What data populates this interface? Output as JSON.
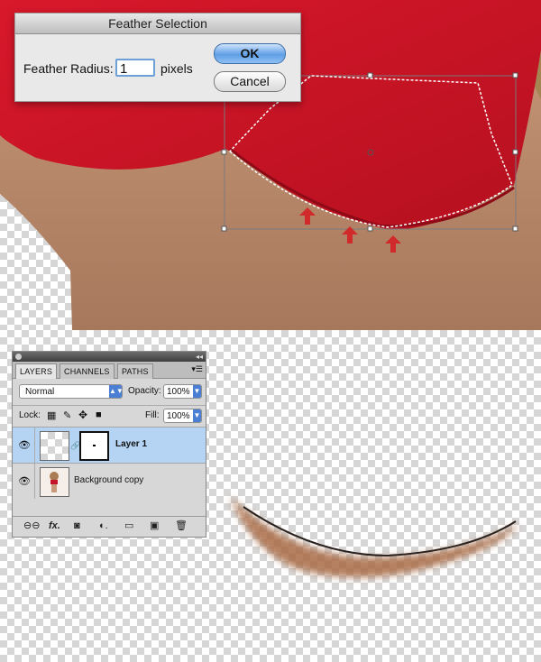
{
  "dialog": {
    "title": "Feather Selection",
    "radius_label": "Feather Radius:",
    "radius_value": "1",
    "unit_label": "pixels",
    "ok_label": "OK",
    "cancel_label": "Cancel"
  },
  "layers_panel": {
    "tabs": [
      "LAYERS",
      "CHANNELS",
      "PATHS"
    ],
    "active_tab": "LAYERS",
    "blend_mode": "Normal",
    "opacity_label": "Opacity:",
    "opacity_value": "100%",
    "lock_label": "Lock:",
    "fill_label": "Fill:",
    "fill_value": "100%",
    "layers": [
      {
        "name": "Layer 1",
        "selected": true,
        "visible": true,
        "has_mask": true
      },
      {
        "name": "Background copy",
        "selected": false,
        "visible": true,
        "has_mask": false
      }
    ],
    "footer_icons": [
      "link-icon",
      "fx-icon",
      "mask-icon",
      "adjustment-icon",
      "folder-icon",
      "new-layer-icon",
      "trash-icon"
    ]
  },
  "colors": {
    "bra_red": "#cf1b2c",
    "skin": "#b08265",
    "annotation_arrow": "#d12a2a",
    "selection_blue": "#b5d3f3"
  }
}
